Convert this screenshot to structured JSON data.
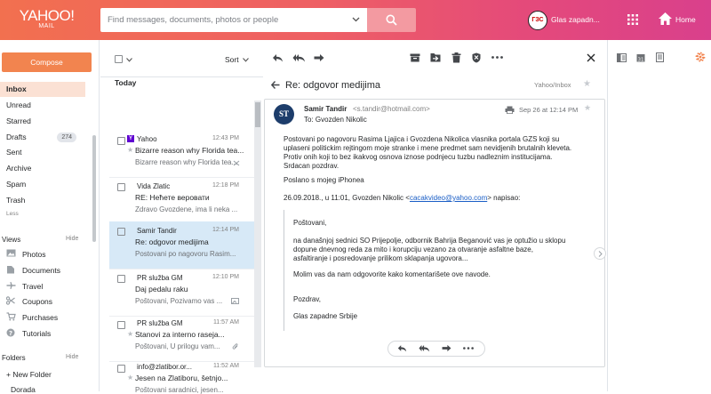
{
  "header": {
    "logo_main": "YAHOO!",
    "logo_sub": "MAIL",
    "search_placeholder": "Find messages, documents, photos or people",
    "account_avatar_text": "ГЗС",
    "account_name": "Glas zapadn...",
    "home_label": "Home"
  },
  "nav": {
    "compose_label": "Compose",
    "folders": [
      {
        "label": "Inbox",
        "count": ""
      },
      {
        "label": "Unread",
        "count": ""
      },
      {
        "label": "Starred",
        "count": ""
      },
      {
        "label": "Drafts",
        "count": "274"
      },
      {
        "label": "Sent",
        "count": ""
      },
      {
        "label": "Archive",
        "count": ""
      },
      {
        "label": "Spam",
        "count": ""
      },
      {
        "label": "Trash",
        "count": ""
      }
    ],
    "less_label": "Less",
    "views_title": "Views",
    "views_hide": "Hide",
    "views": [
      "Photos",
      "Documents",
      "Travel",
      "Coupons",
      "Purchases",
      "Tutorials"
    ],
    "folders_title": "Folders",
    "folders_hide": "Hide",
    "new_folder": "+ New Folder",
    "extra_folder": "Dorada"
  },
  "list": {
    "sort_label": "Sort",
    "group_label": "Today",
    "messages": [
      {
        "sender": "Yahoo",
        "time": "12:43 PM",
        "subject": "Bizarre reason why Florida tea...",
        "snippet": "Bizarre reason why Florida tea..."
      },
      {
        "sender": "Vida Zlatic",
        "time": "12:18 PM",
        "subject": "RE: Нећете веровати",
        "snippet": "Zdravo Gvozdene, ima li neka ..."
      },
      {
        "sender": "Samir Tandir",
        "time": "12:14 PM",
        "subject": "Re: odgovor medijima",
        "snippet": "Postovani po nagovoru Rasim..."
      },
      {
        "sender": "PR služba GM",
        "time": "12:10 PM",
        "subject": "Daj pedalu raku",
        "snippet": "Poštovani, Pozivamo vas ..."
      },
      {
        "sender": "PR služba GM",
        "time": "11:57 AM",
        "subject": "Stanovi za interno raseja...",
        "snippet": "Poštovani, U prilogu vam..."
      },
      {
        "sender": "info@zlatibor.or...",
        "time": "11:52 AM",
        "subject": "Jesen na Zlatiboru, šetnjo...",
        "snippet": "Poštovani saradnici, jesen..."
      }
    ]
  },
  "message": {
    "subject": "Re: odgovor medijima",
    "folder_path": "Yahoo/Inbox",
    "avatar_text": "ST",
    "from_name": "Samir Tandir",
    "from_addr": "<s.tandir@hotmail.com>",
    "to_line": "To: Gvozden Nikolic",
    "date": "Sep 26 at 12:14 PM",
    "body_lines": [
      "Postovani po nagovoru Rasima Ljajica i Gvozdena Nikolica vlasnika portala GZS koji su",
      "uplaseni politickim rejtingom moje stranke i mene predmet sam nevidjenih brutalnih kleveta.",
      "Protiv onih koji to bez ikakvog osnova iznose podnjecu tuzbu nadleznim institucijama.",
      "Srdacan pozdrav."
    ],
    "sent_from": "Poslano s mojeg iPhonea",
    "quote_intro_pre": "26.09.2018., u 11:01, Gvozden Nikolic <",
    "quote_email": "cacakvideo@yahoo.com",
    "quote_intro_post": "> napisao:",
    "quote_greeting": "Poštovani,",
    "quote_lines": [
      "na današnjoj sednici SO Prijepolje, odbornik Bahrija Beganović vas je optužio u sklopu",
      "dopune dnevnog reda za mito i korupciju vezano za otvaranje asfaltne baze,",
      "asfaltiranje i posredovanje prilikom sklapanja ugovora..."
    ],
    "quote_request": "Molim vas da nam odgovorite kako komentarišete ove navode.",
    "quote_regards": "Pozdrav,",
    "quote_signature": "Glas zapadne Srbije"
  },
  "colors": {
    "header_start": "#f2704f",
    "header_end": "#d9408c",
    "compose": "#f2844f",
    "selected_folder": "#fbe1d4",
    "selected_row": "#d7e9f7",
    "rail_accent": "#f2844f"
  }
}
